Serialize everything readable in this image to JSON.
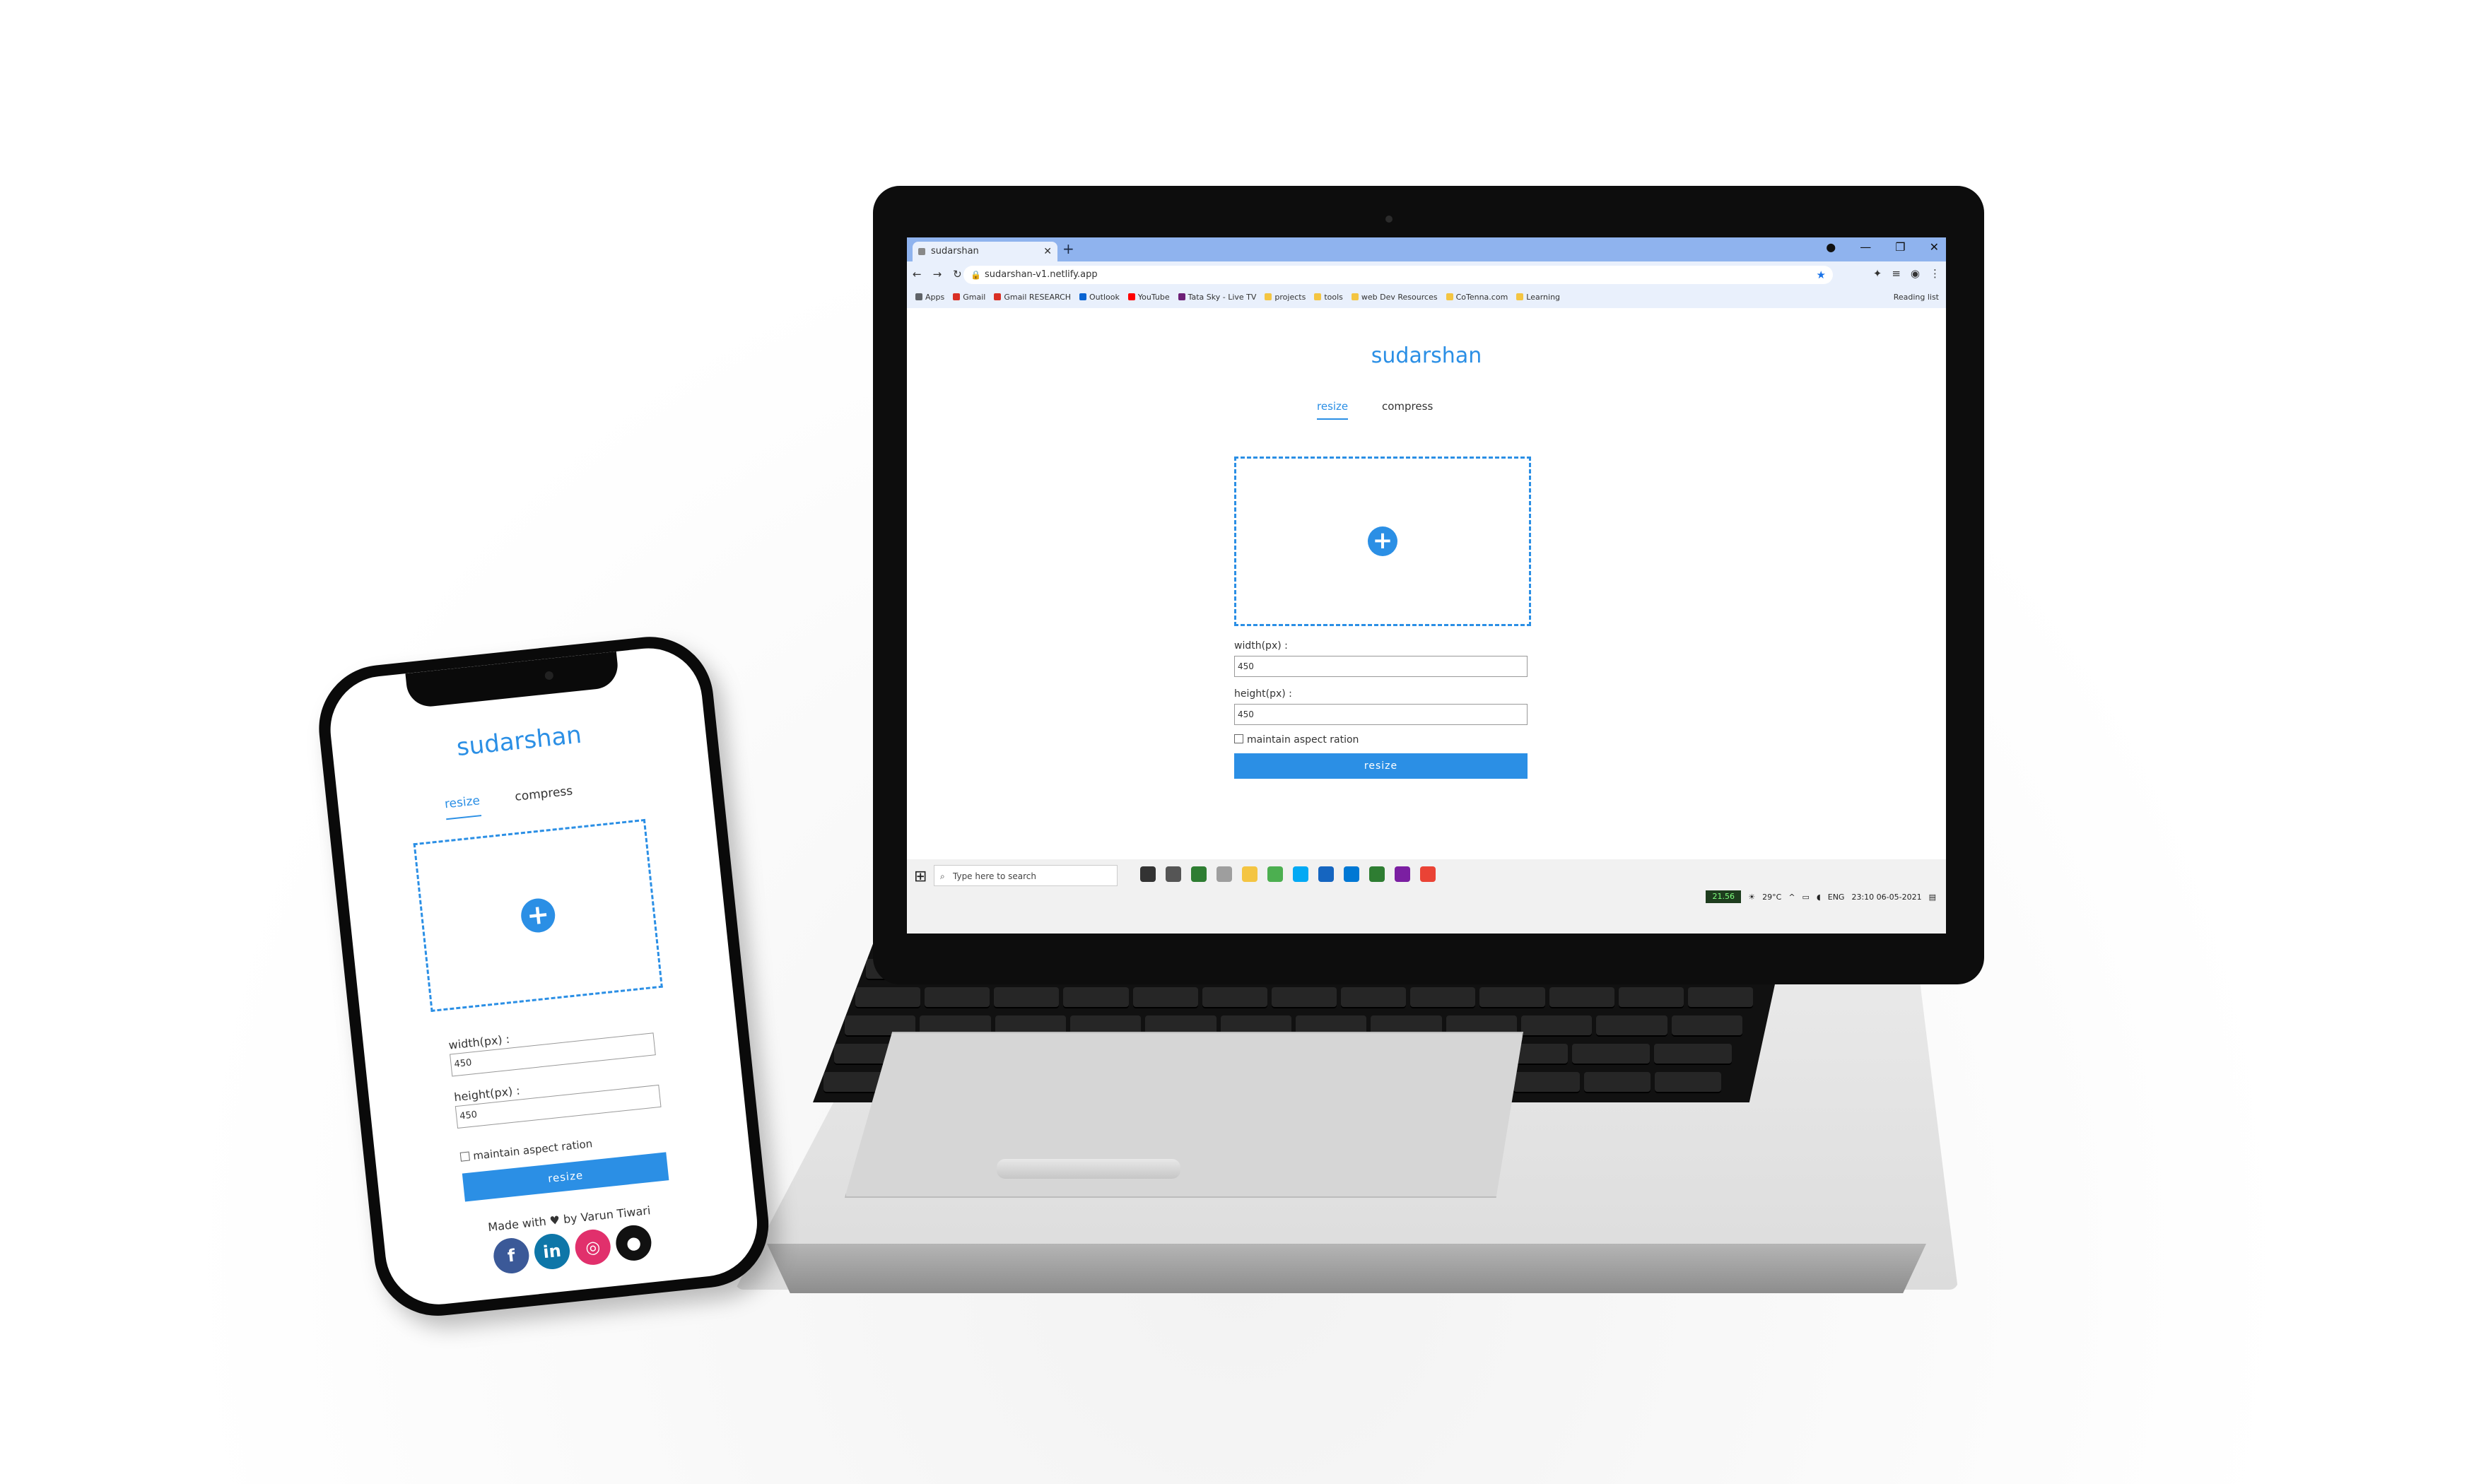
{
  "browser": {
    "tab_title": "sudarshan",
    "new_tab": "+",
    "url": "sudarshan-v1.netlify.app",
    "bookmarks": [
      {
        "label": "Apps",
        "color": "#5f6368"
      },
      {
        "label": "Gmail",
        "color": "#d93025"
      },
      {
        "label": "Gmail RESEARCH",
        "color": "#d93025"
      },
      {
        "label": "Outlook",
        "color": "#0a64d2"
      },
      {
        "label": "YouTube",
        "color": "#ff0000"
      },
      {
        "label": "Tata Sky - Live TV",
        "color": "#6d2077"
      },
      {
        "label": "projects",
        "color": "#f4c542"
      },
      {
        "label": "tools",
        "color": "#f4c542"
      },
      {
        "label": "web Dev Resources",
        "color": "#f4c542"
      },
      {
        "label": "CoTenna.com",
        "color": "#f4c542"
      },
      {
        "label": "Learning",
        "color": "#f4c542"
      }
    ],
    "reading_list": "Reading list"
  },
  "app": {
    "brand": "sudarshan",
    "tab_resize": "resize",
    "tab_compress": "compress",
    "upload_icon": "plus-circle-icon",
    "width_label": "width(px) :",
    "width_value": "450",
    "height_label": "height(px) :",
    "height_value": "450",
    "aspect_label": "maintain aspect ration",
    "resize_button": "resize",
    "accent": "#2b8fe5"
  },
  "taskbar": {
    "search_placeholder": "Type here to search",
    "temp": "29°C",
    "lang": "ENG",
    "time": "23:10",
    "date": "06-05-2021",
    "tray_badge": "21.56"
  },
  "phone": {
    "footer_made": "Made with",
    "footer_heart": "♥",
    "footer_by": "by Varun Tiwari",
    "socials": [
      {
        "name": "facebook",
        "glyph": "f",
        "color": "#3b5998"
      },
      {
        "name": "linkedin",
        "glyph": "in",
        "color": "#0e76a8"
      },
      {
        "name": "instagram",
        "glyph": "◎",
        "color": "#e1306c"
      },
      {
        "name": "github",
        "glyph": "●",
        "color": "#111111"
      }
    ]
  }
}
